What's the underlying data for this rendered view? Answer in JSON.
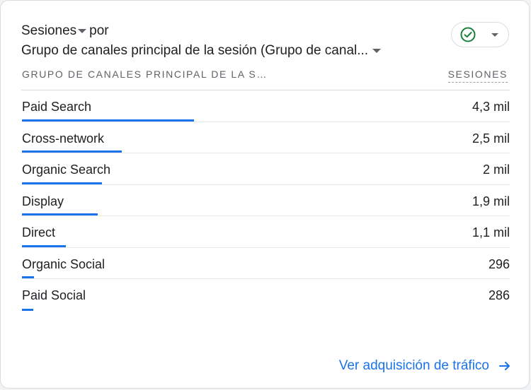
{
  "card": {
    "title_metric": "Sesiones",
    "title_connector": "por",
    "title_dimension": "Grupo de canales principal de la sesión (Grupo de canal...",
    "status_icon": "check-circle-icon",
    "colors": {
      "accent": "#1a73e8",
      "status_ok": "#188038",
      "text": "#202124",
      "muted": "#5f6368"
    }
  },
  "table": {
    "column_dimension": "GRUPO DE CANALES PRINCIPAL DE LA S…",
    "column_metric": "SESIONES",
    "rows": [
      {
        "label": "Paid Search",
        "value": "4,3 mil",
        "sessions": 4300
      },
      {
        "label": "Cross-network",
        "value": "2,5 mil",
        "sessions": 2500
      },
      {
        "label": "Organic Search",
        "value": "2 mil",
        "sessions": 2000
      },
      {
        "label": "Display",
        "value": "1,9 mil",
        "sessions": 1900
      },
      {
        "label": "Direct",
        "value": "1,1 mil",
        "sessions": 1100
      },
      {
        "label": "Organic Social",
        "value": "296",
        "sessions": 296
      },
      {
        "label": "Paid Social",
        "value": "286",
        "sessions": 286
      }
    ]
  },
  "footer": {
    "link_label": "Ver adquisición de tráfico",
    "link_icon": "arrow-right-icon"
  }
}
